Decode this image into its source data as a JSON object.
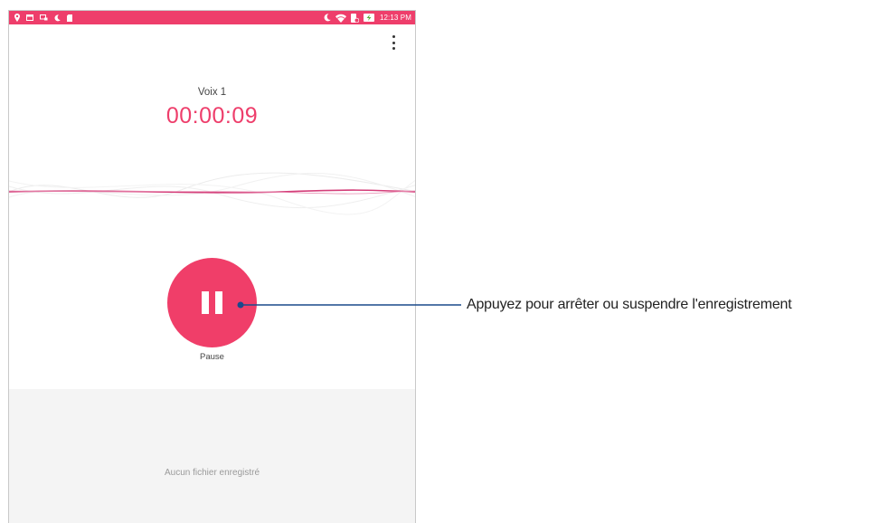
{
  "status_bar": {
    "time": "12:13 PM",
    "left_icons": [
      "location-icon",
      "calendar-icon",
      "screen-icon",
      "moon-icon",
      "sd-card-icon"
    ],
    "right_icons": [
      "moon-icon",
      "wifi-icon",
      "battery-saver-icon",
      "battery-charging-icon"
    ]
  },
  "recorder": {
    "recording_name": "Voix 1",
    "elapsed_time": "00:00:09",
    "pause_label": "Pause",
    "accent_color": "#ee3e6b"
  },
  "files": {
    "empty_message": "Aucun fichier enregistré"
  },
  "annotation": {
    "text": "Appuyez pour arrêter ou suspendre l'enregistrement",
    "line_color": "#1a4a8c"
  }
}
